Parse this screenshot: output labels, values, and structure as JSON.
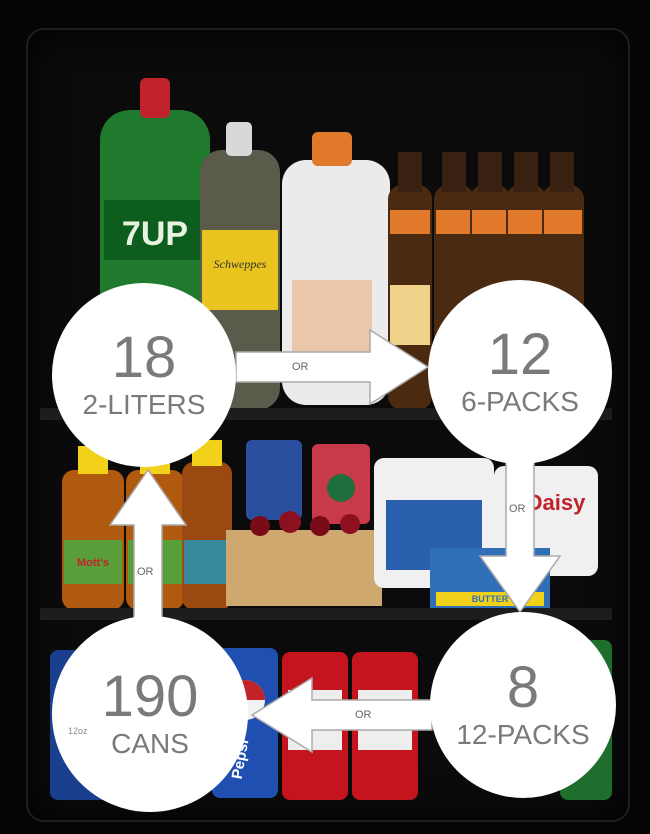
{
  "items": [
    {
      "count": "18",
      "label": "2-LITERS"
    },
    {
      "count": "12",
      "label": "6-PACKS"
    },
    {
      "count": "8",
      "label": "12-PACKS"
    },
    {
      "count": "190",
      "label": "CANS",
      "unit": "12oz"
    }
  ],
  "connector_label": "OR",
  "product_labels": {
    "soda_bottle": "7UP",
    "mixer_bottle": "Schweppes",
    "can_cola": "Pepsi",
    "juice": "Mott's",
    "cream_cheese": "Daisy",
    "butter": "BUTTER"
  },
  "colors": {
    "circle": "#ffffff",
    "number_text": "#7a7a7a",
    "background": "#050505"
  }
}
